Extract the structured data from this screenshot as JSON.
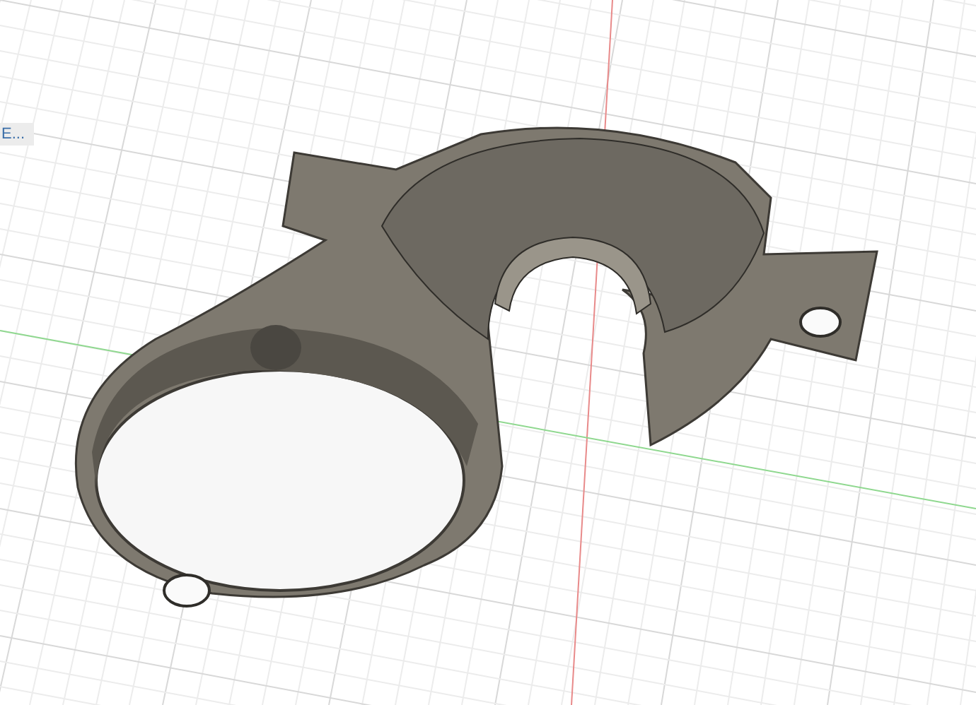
{
  "viewport_label": {
    "text": "E..."
  }
}
